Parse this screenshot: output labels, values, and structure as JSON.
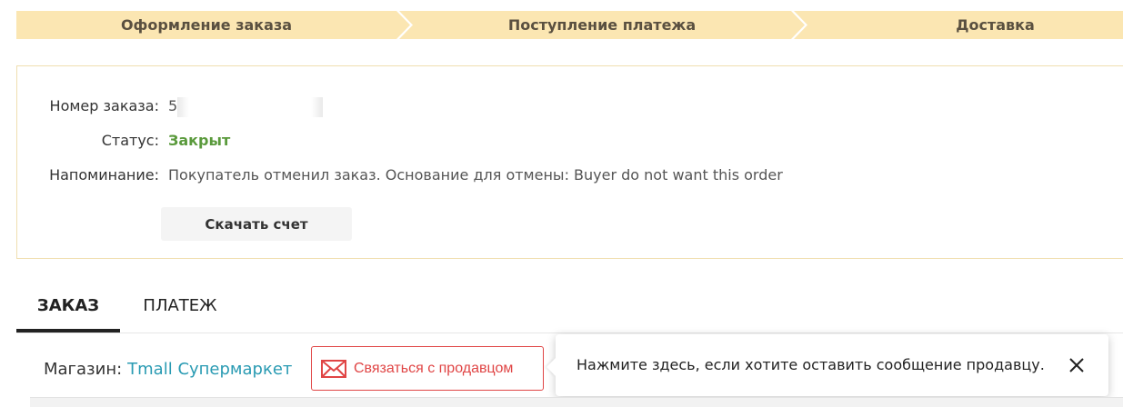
{
  "progress": {
    "steps": [
      {
        "label": "Оформление заказа"
      },
      {
        "label": "Поступление платежа"
      },
      {
        "label": "Доставка"
      }
    ],
    "color": "#fbe6b2"
  },
  "order": {
    "number_label": "Номер заказа:",
    "number_value": "5",
    "status_label": "Статус:",
    "status_value": "Закрыт",
    "reminder_label": "Напоминание:",
    "reminder_value": "Покупатель отменил заказ. Основание для отмены: Buyer do not want this order",
    "download_label": "Скачать счет"
  },
  "tabs": [
    {
      "label": "ЗАКАЗ",
      "active": true
    },
    {
      "label": "ПЛАТЕЖ",
      "active": false
    }
  ],
  "store": {
    "label": "Магазин:",
    "name": "Tmall Супермаркет",
    "contact_label": "Связаться с продавцом"
  },
  "tooltip": {
    "text": "Нажмите здесь, если хотите оставить сообщение продавцу."
  },
  "colors": {
    "accent_red": "#e04545",
    "link_blue": "#2a9bb3",
    "status_green": "#5a9a3c"
  },
  "icons": {
    "contact": "mail-icon",
    "tooltip_close": "close-icon"
  }
}
